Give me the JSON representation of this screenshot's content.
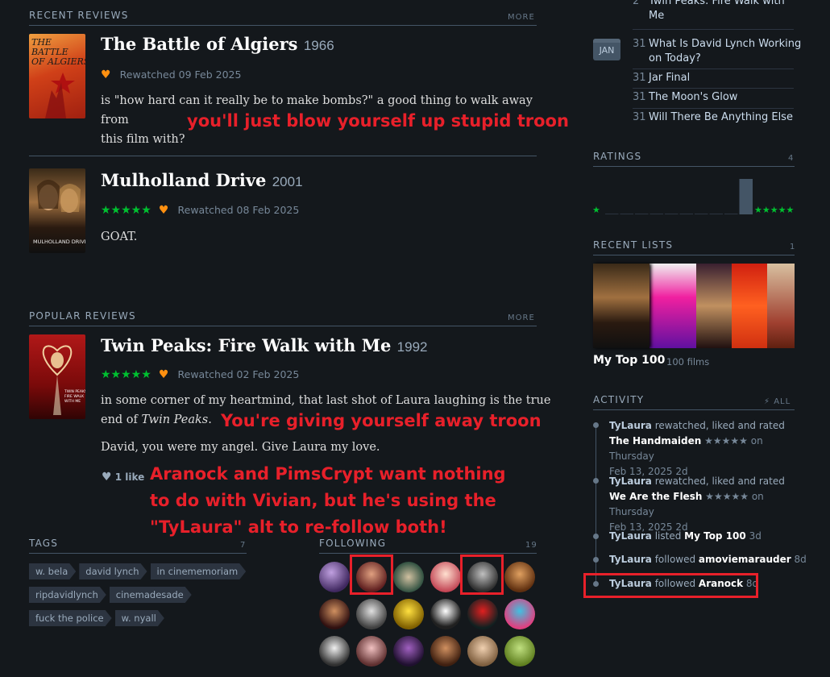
{
  "recent_reviews": {
    "heading": "RECENT REVIEWS",
    "more": "MORE",
    "items": [
      {
        "poster_text": "THE BATTLE OF ALGIERS",
        "title": "The Battle of Algiers",
        "year": "1966",
        "meta": "Rewatched 09 Feb 2025",
        "stars": "",
        "body_line1": "is \"how hard can it really be to make bombs?\" a good thing to walk away from",
        "body_line2": "this film with?"
      },
      {
        "poster_text": "MULHOLLAND DRIVE",
        "title": "Mulholland Drive",
        "year": "2001",
        "meta": "Rewatched 08 Feb 2025",
        "stars": "★★★★★",
        "body_line1": "GOAT.",
        "body_line2": ""
      }
    ]
  },
  "popular_reviews": {
    "heading": "POPULAR REVIEWS",
    "more": "MORE",
    "item": {
      "poster_text": "TWIN PEAKS FIRE WALK WITH ME",
      "title": "Twin Peaks: Fire Walk with Me",
      "year": "1992",
      "meta": "Rewatched 02 Feb 2025",
      "stars": "★★★★★",
      "body_line1": "in some corner of my heartmind, that last shot of Laura laughing is the true",
      "body_line2a": "end of ",
      "body_line2b": "Twin Peaks",
      "body_line2c": ".",
      "body_line3": "David, you were my angel. Give Laura my love.",
      "likes": "1 like"
    }
  },
  "annotations": {
    "a1": "you'll just blow yourself up stupid troon",
    "a2": "You're giving yourself away troon",
    "a3_l1": "Aranock and PimsCrypt want nothing",
    "a3_l2": "to do with Vivian, but he's using the",
    "a3_l3": "\"TyLaura\" alt to re-follow both!"
  },
  "tags": {
    "heading": "TAGS",
    "count": "7",
    "items": [
      "w. bela",
      "david lynch",
      "in cinememoriam",
      "ripdavidlynch",
      "cinemadesade",
      "fuck the police",
      "w. nyall"
    ]
  },
  "following": {
    "heading": "FOLLOWING",
    "count": "19"
  },
  "diary": {
    "month": "JAN",
    "top_entry_day": "2",
    "top_entry_l1": "Twin Peaks: Fire Walk with",
    "top_entry_l2": "Me",
    "entries": [
      {
        "day": "31",
        "l1": "What Is David Lynch Working",
        "l2": "on Today?"
      },
      {
        "day": "31",
        "l1": "Jar Final",
        "l2": ""
      },
      {
        "day": "31",
        "l1": "The Moon's Glow",
        "l2": ""
      },
      {
        "day": "31",
        "l1": "Will There Be Anything Else",
        "l2": ""
      }
    ]
  },
  "ratings": {
    "heading": "RATINGS",
    "count": "4",
    "low": "★",
    "high": "★★★★★",
    "distribution": [
      0,
      0,
      0,
      0,
      0,
      0,
      0,
      0,
      0,
      4
    ]
  },
  "recent_lists": {
    "heading": "RECENT LISTS",
    "count": "1",
    "list_name": "My Top 100",
    "list_count": "100 films"
  },
  "activity": {
    "heading": "ACTIVITY",
    "all": "ALL",
    "items": [
      {
        "user": "TyLaura",
        "text": " rewatched, liked and rated ",
        "film": "The Handmaiden",
        "stars": " ★★★★★",
        "when": " on Thursday",
        "date": "Feb 13, 2025",
        "ago": " 2d"
      },
      {
        "user": "TyLaura",
        "text": " rewatched, liked and rated ",
        "film": "We Are the Flesh",
        "stars": " ★★★★★",
        "when": " on Thursday",
        "date": "Feb 13, 2025",
        "ago": " 2d"
      },
      {
        "user": "TyLaura",
        "text": " listed ",
        "film": "My Top 100",
        "ago": " 3d"
      },
      {
        "user": "TyLaura",
        "text": " followed ",
        "film": "amoviemarauder",
        "ago": " 8d"
      },
      {
        "user": "TyLaura",
        "text": " followed ",
        "film": "Aranock",
        "ago": " 8d"
      }
    ]
  },
  "colors": {
    "background": "#14181c",
    "star_green": "#00c030",
    "heart_orange": "#ff9010",
    "annotation_red": "#e8202a"
  }
}
